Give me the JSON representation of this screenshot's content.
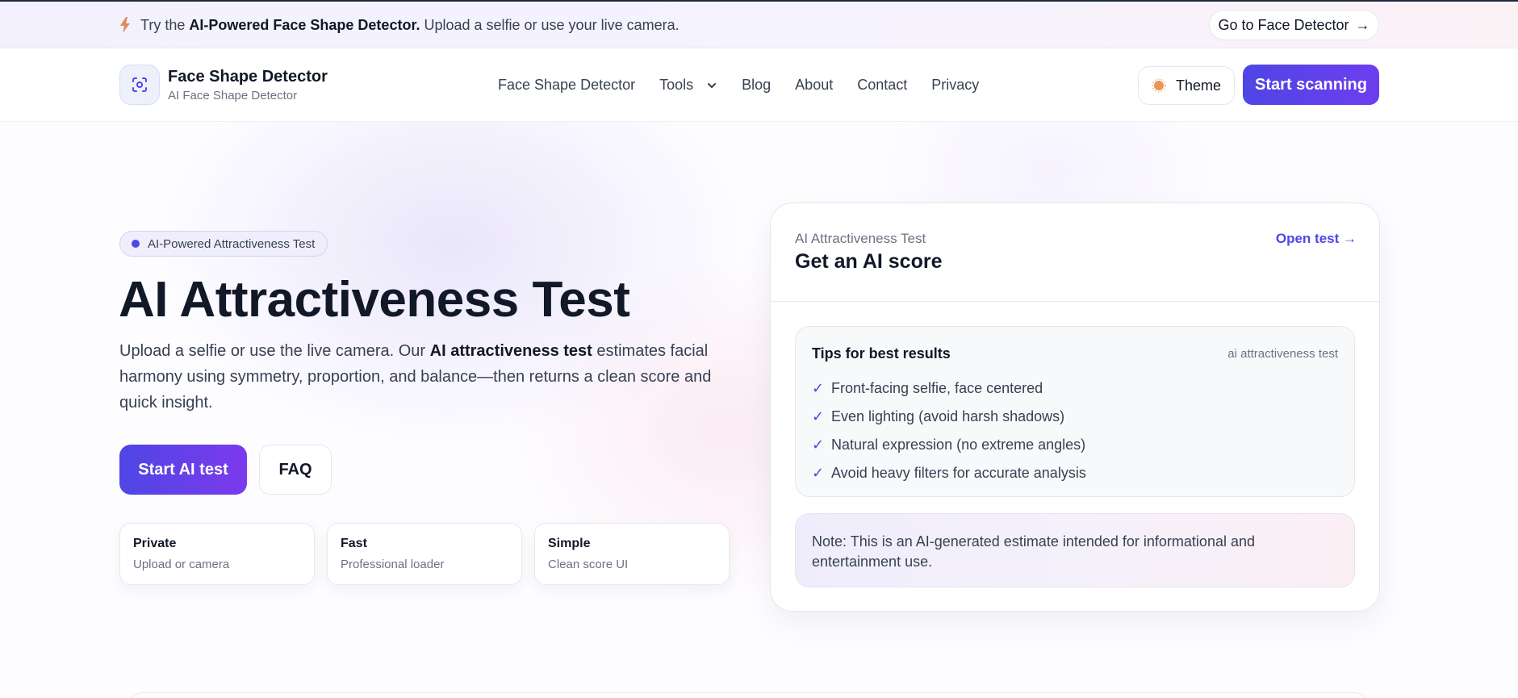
{
  "announcement": {
    "pre": "Try the",
    "bold": "AI-Powered Face Shape Detector.",
    "post": "Upload a selfie or use your live camera.",
    "button_label": "Go to Face Detector",
    "button_arrow": "→"
  },
  "header": {
    "brand_title": "Face Shape Detector",
    "brand_subtitle": "AI Face Shape Detector",
    "nav": [
      {
        "label": "Face Shape Detector"
      },
      {
        "label": "Tools"
      },
      {
        "label": "Blog"
      },
      {
        "label": "About"
      },
      {
        "label": "Contact"
      },
      {
        "label": "Privacy"
      }
    ],
    "theme_label": "Theme",
    "start_label": "Start scanning"
  },
  "hero": {
    "pill": "AI-Powered Attractiveness Test",
    "title": "AI Attractiveness Test",
    "desc_pre": "Upload a selfie or use the live camera. Our",
    "desc_bold": "AI attractiveness test",
    "desc_post": "estimates facial harmony using symmetry, proportion, and balance—then returns a clean score and quick insight.",
    "cta_primary": "Start AI test",
    "cta_secondary": "FAQ",
    "features": [
      {
        "title": "Private",
        "subtitle": "Upload or camera"
      },
      {
        "title": "Fast",
        "subtitle": "Professional loader"
      },
      {
        "title": "Simple",
        "subtitle": "Clean score UI"
      }
    ]
  },
  "card": {
    "subtitle": "AI Attractiveness Test",
    "title": "Get an AI score",
    "link": "Open test →",
    "tips_title": "Tips for best results",
    "tips_tag": "ai attractiveness test",
    "tips": [
      "Front-facing selfie, face centered",
      "Even lighting (avoid harsh shadows)",
      "Natural expression (no extreme angles)",
      "Avoid heavy filters for accurate analysis"
    ],
    "check_mark": "✓",
    "note": "Note: This is an AI-generated estimate intended for informational and entertainment use."
  },
  "colors": {
    "accent": "#4f46e5",
    "accent_gradient_end": "#7c3aed",
    "bolt": "#e0895a",
    "theme_sun": "#e8955a"
  },
  "icons": {
    "announcement": "lightning-bolt-icon",
    "logo": "face-scan-icon",
    "tools_menu": "chevron-down-icon",
    "theme": "sun-icon"
  }
}
